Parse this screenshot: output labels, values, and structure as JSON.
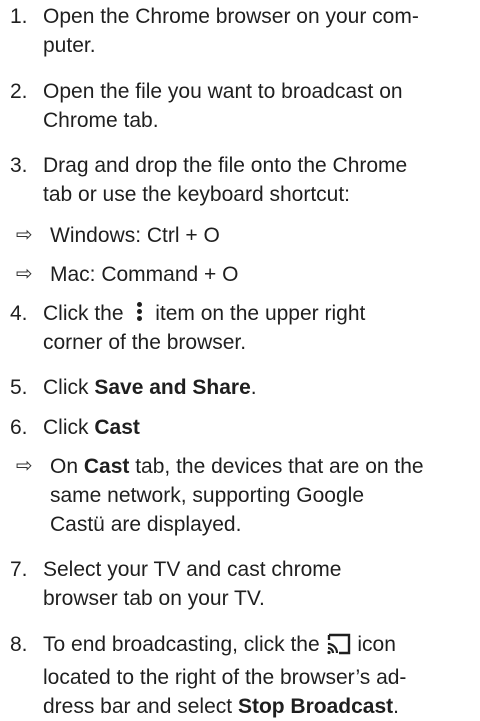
{
  "steps": [
    {
      "num": "1.",
      "lines": [
        "Open the Chrome browser on your com-",
        "puter."
      ]
    },
    {
      "num": "2.",
      "lines": [
        "Open the file you want to broadcast on",
        "Chrome tab."
      ]
    },
    {
      "num": "3.",
      "lines": [
        "Drag and drop the file onto the Chrome",
        "tab or use the keyboard shortcut:"
      ]
    },
    {
      "num": "4.",
      "pre": "Click the",
      "post": "item on the upper right",
      "line2": "corner of the browser.",
      "icon": "kebab-menu-icon"
    },
    {
      "num": "5.",
      "pre": "Click ",
      "bold": "Save and Share",
      "post": "."
    },
    {
      "num": "6.",
      "pre": "Click ",
      "bold": "Cast"
    },
    {
      "num": "7.",
      "lines": [
        "Select your TV and cast chrome",
        "browser tab on your TV."
      ]
    },
    {
      "num": "8.",
      "pre": "To end broadcasting, click the",
      "post": "icon",
      "line2": "located to the right of the browser’s ad-",
      "line3_pre": "dress bar and select ",
      "line3_bold": "Stop Broadcast",
      "line3_post": ".",
      "icon": "cast-icon"
    }
  ],
  "subs": {
    "windows": "Windows: Ctrl + O",
    "mac": "Mac: Command + O",
    "cast_pre": "On ",
    "cast_bold": "Cast",
    "cast_post": " tab, the devices that are on the",
    "cast_line2": "same network, supporting Google",
    "cast_line3": "Castü are displayed."
  },
  "arrow_glyph": "⇨"
}
